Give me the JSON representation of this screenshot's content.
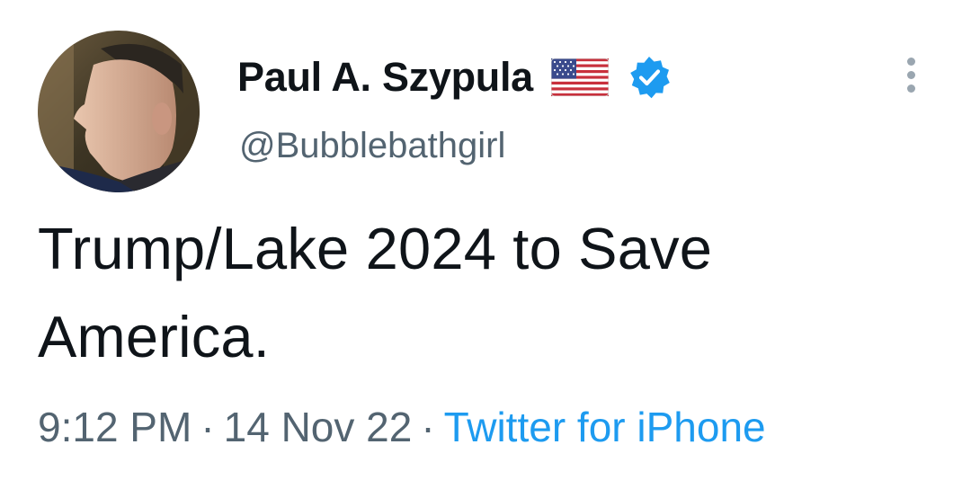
{
  "author": {
    "display_name": "Paul A. Szypula",
    "flag_icon": "us-flag-emoji",
    "verified_icon": "verified-badge-icon",
    "handle": "@Bubblebathgirl",
    "avatar": "profile-photo"
  },
  "tweet": {
    "text": "Trump/Lake 2024 to Save America."
  },
  "meta": {
    "time": "9:12 PM",
    "separator": "·",
    "date": "14 Nov 22",
    "source": "Twitter for iPhone"
  },
  "menu": {
    "icon": "more-options-icon"
  },
  "colors": {
    "text_primary": "#0f1419",
    "text_secondary": "#536471",
    "link": "#1d9bf0",
    "verified_blue": "#1d9bf0"
  }
}
